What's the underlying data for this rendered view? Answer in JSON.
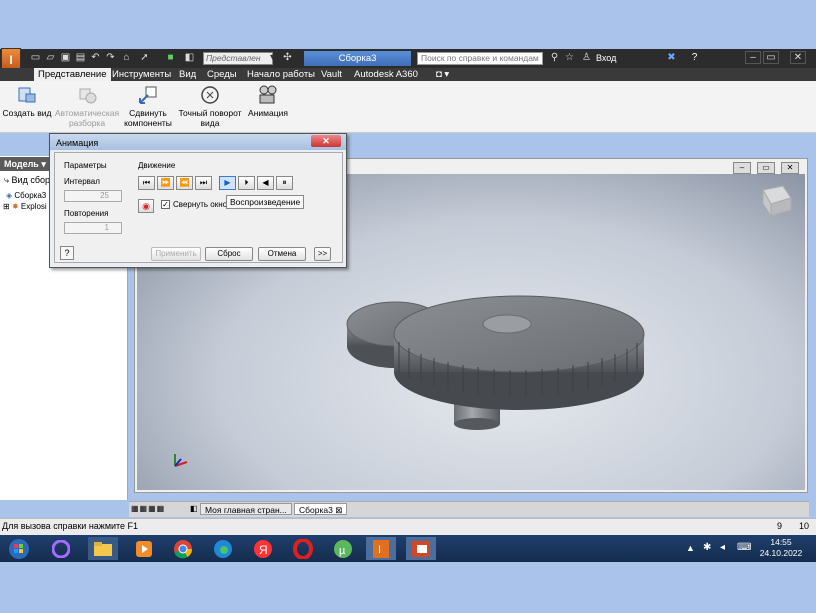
{
  "titlebar": {
    "preset_placeholder": "Представлен",
    "document_title": "Сборка3",
    "search_placeholder": "Поиск по справке и командам",
    "signin_label": "Вход"
  },
  "ribbon_tabs": [
    "Представление",
    "Инструменты",
    "Вид",
    "Среды",
    "Начало работы",
    "Vault",
    "Autodesk A360"
  ],
  "ribbon_buttons": [
    {
      "label": "Создать вид",
      "enabled": true
    },
    {
      "label": "Автоматическая разборка",
      "enabled": false
    },
    {
      "label": "Сдвинуть компоненты",
      "enabled": true
    },
    {
      "label": "Точный поворот вида",
      "enabled": true
    },
    {
      "label": "Анимация",
      "enabled": true
    }
  ],
  "model_panel": {
    "header": "Модель",
    "view_label": "Вид сбор",
    "tree": [
      "Сборка3",
      "Explosi"
    ]
  },
  "dialog": {
    "title": "Анимация",
    "params_label": "Параметры",
    "interval_label": "Интервал",
    "interval_value": "25",
    "repeats_label": "Повторения",
    "repeats_value": "1",
    "motion_label": "Движение",
    "minimize_label": "Свернуть окно п",
    "tooltip": "Воспроизведение",
    "apply_label": "Применить",
    "reset_label": "Сброс",
    "cancel_label": "Отмена",
    "more_label": ">>"
  },
  "doc_tabs": [
    "Моя главная стран...",
    "Сборка3"
  ],
  "statusbar": {
    "help_text": "Для вызова справки нажмите F1",
    "num1": "9",
    "num2": "10"
  },
  "taskbar": {
    "time": "14:55",
    "date": "24.10.2022"
  },
  "colors": {
    "accent_blue": "#3f6fb8",
    "logo_orange": "#e0701f",
    "taskbar": "#1a355e"
  }
}
